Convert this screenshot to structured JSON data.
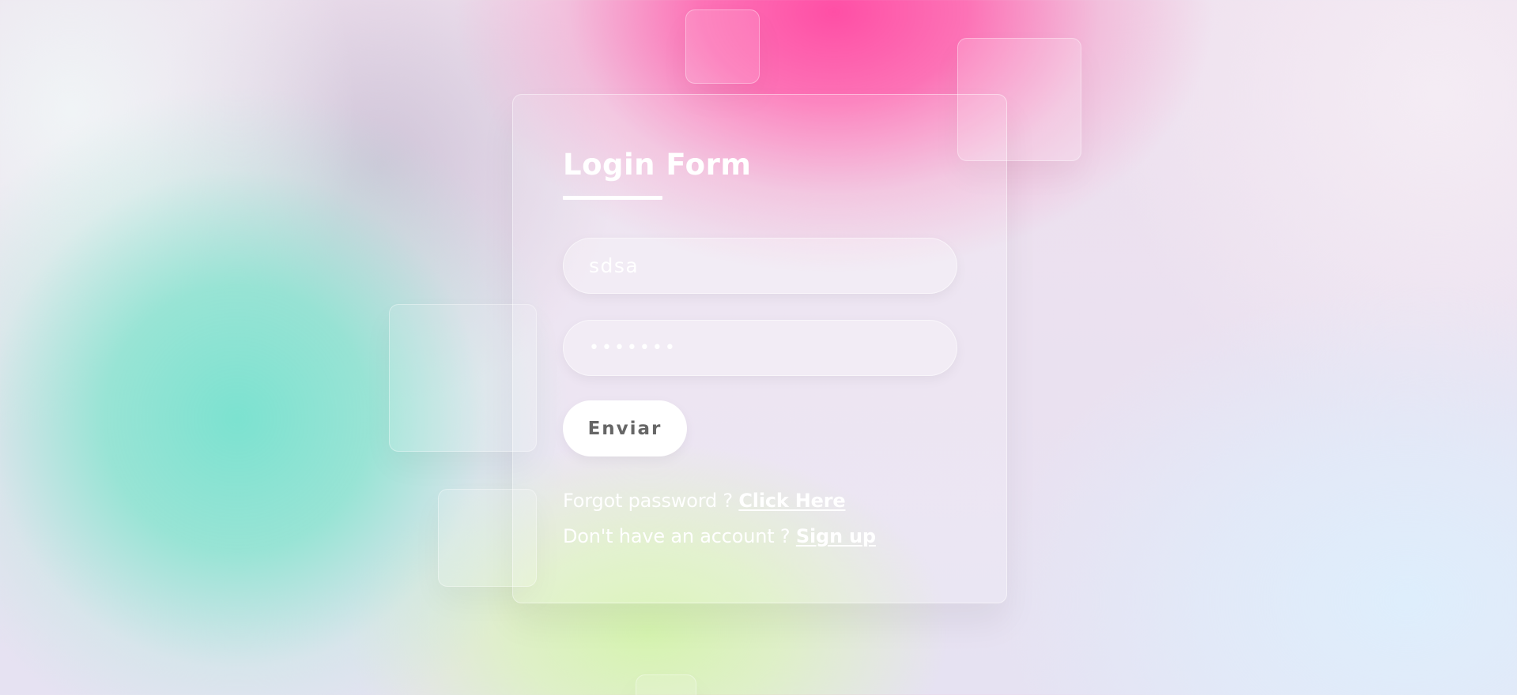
{
  "form": {
    "title": "Login Form",
    "username_value": "sdsa",
    "password_value": "•••••••",
    "submit_label": "Enviar"
  },
  "links": {
    "forgot_text": "Forgot password ? ",
    "forgot_link": "Click Here",
    "signup_text": "Don't have an account ? ",
    "signup_link": "Sign up"
  },
  "colors": {
    "text": "#ffffff",
    "button_text": "#666666",
    "button_bg": "#ffffff",
    "accent_pink": "#ff4ca4",
    "accent_teal": "#7ce2d0",
    "accent_lime": "#d6f4b0"
  }
}
